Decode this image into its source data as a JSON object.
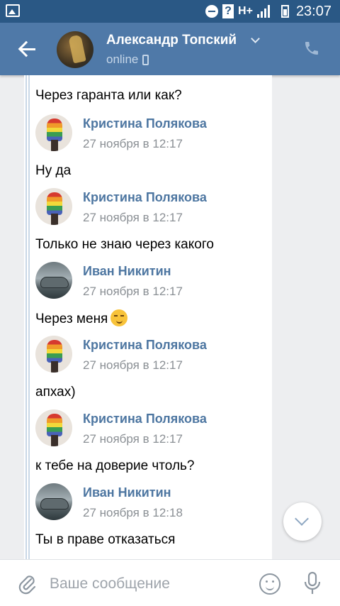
{
  "status_bar": {
    "network": "H+",
    "time": "23:07"
  },
  "header": {
    "contact_name": "Александр Топский",
    "contact_status": "online"
  },
  "messages": [
    {
      "text": "Через гаранта или как?"
    },
    {
      "author": "Кристина Полякова",
      "time": "27 ноября в 12:17",
      "text": "Ну да"
    },
    {
      "author": "Кристина Полякова",
      "time": "27 ноября в 12:17",
      "text": "Только не знаю через какого"
    },
    {
      "author": "Иван Никитин",
      "time": "27 ноября в 12:17",
      "text": "Через меня"
    },
    {
      "author": "Кристина Полякова",
      "time": "27 ноября в 12:17",
      "text": "апхах)"
    },
    {
      "author": "Кристина Полякова",
      "time": "27 ноября в 12:17",
      "text": "к тебе на доверие чтоль?"
    },
    {
      "author": "Иван Никитин",
      "time": "27 ноября в 12:18",
      "text": "Ты в праве отказаться"
    }
  ],
  "composer": {
    "placeholder": "Ваше сообщение"
  },
  "colors": {
    "header_bg": "#4f79a8",
    "status_bar_bg": "#2a5885",
    "author_name": "#4d76a1"
  },
  "icons": [
    "image-icon",
    "do-not-disturb-icon",
    "signal-icon",
    "battery-icon",
    "back-arrow-icon",
    "chevron-down-icon",
    "phone-icon",
    "mobile-icon",
    "smirk-emoji-icon",
    "scroll-down-icon",
    "attach-icon",
    "emoji-icon",
    "microphone-icon"
  ]
}
